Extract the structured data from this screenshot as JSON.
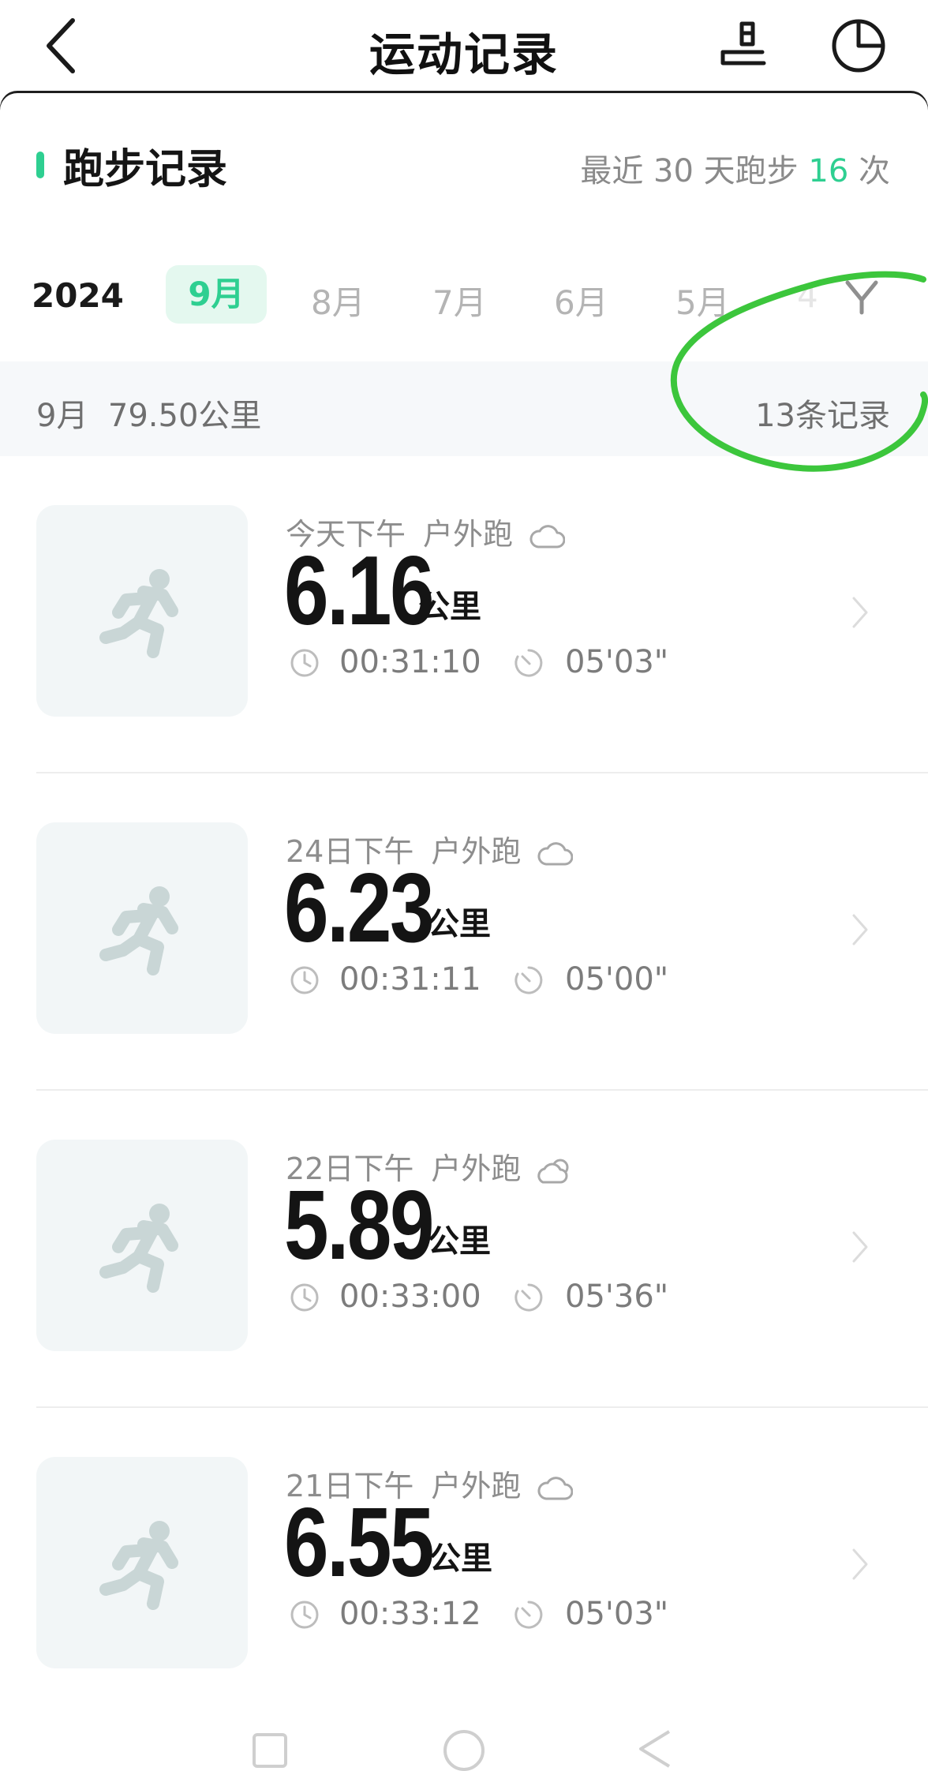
{
  "header": {
    "title": "运动记录",
    "back_icon": "chevron-left-icon",
    "share_icon": "export-icon",
    "stats_icon": "pie-chart-icon"
  },
  "section": {
    "title": "跑步记录",
    "summary_prefix": "最近 30 天跑步 ",
    "summary_count": "16",
    "summary_suffix": " 次",
    "accent_color": "#2ecf91"
  },
  "month_filter": {
    "year": "2024",
    "active_month": "9月",
    "months": [
      "8月",
      "7月",
      "6月",
      "5月"
    ],
    "faded_month": "4",
    "filter_icon": "filter-icon"
  },
  "month_summary": {
    "left": "9月  79.50公里",
    "right": "13条记录"
  },
  "runs": [
    {
      "date": "今天下午",
      "type": "户外跑",
      "weather_icon": "cloud-icon",
      "distance": "6.16",
      "unit": "公里",
      "duration": "00:31:10",
      "pace": "05'03\""
    },
    {
      "date": "24日下午",
      "type": "户外跑",
      "weather_icon": "cloud-icon",
      "distance": "6.23",
      "unit": "公里",
      "duration": "00:31:11",
      "pace": "05'00\""
    },
    {
      "date": "22日下午",
      "type": "户外跑",
      "weather_icon": "partly-cloudy-icon",
      "distance": "5.89",
      "unit": "公里",
      "duration": "00:33:00",
      "pace": "05'36\""
    },
    {
      "date": "21日下午",
      "type": "户外跑",
      "weather_icon": "cloud-icon",
      "distance": "6.55",
      "unit": "公里",
      "duration": "00:33:12",
      "pace": "05'03\""
    }
  ]
}
